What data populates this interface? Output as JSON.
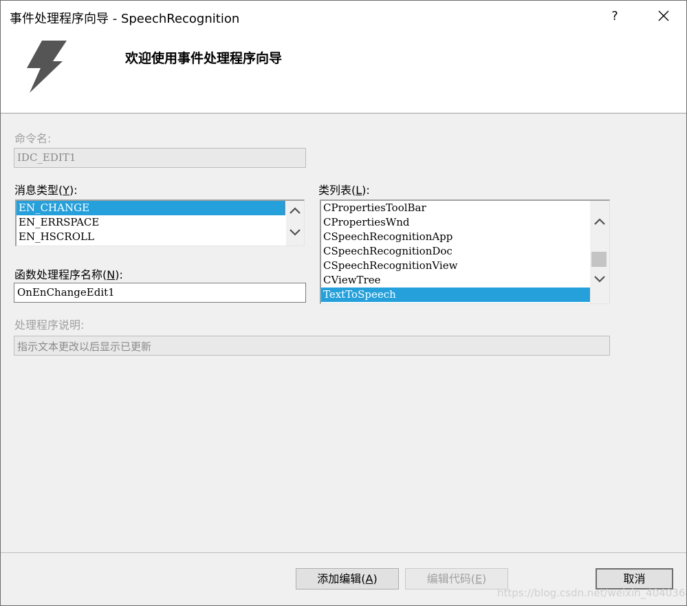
{
  "window": {
    "title": "事件处理程序向导 - SpeechRecognition",
    "help_label": "?",
    "close_icon": "close-icon"
  },
  "header": {
    "title": "欢迎使用事件处理程序向导",
    "icon": "lightning-bolt-icon"
  },
  "command_name": {
    "label": "命令名:",
    "value": "IDC_EDIT1"
  },
  "message_type": {
    "label_pre": "消息类型(",
    "label_key": "Y",
    "label_post": "):",
    "items": [
      "EN_CHANGE",
      "EN_ERRSPACE",
      "EN_HSCROLL"
    ],
    "selected": "EN_CHANGE"
  },
  "class_list": {
    "label_pre": "类列表(",
    "label_key": "L",
    "label_post": "):",
    "items": [
      "CPropertiesToolBar",
      "CPropertiesWnd",
      "CSpeechRecognitionApp",
      "CSpeechRecognitionDoc",
      "CSpeechRecognitionView",
      "CViewTree",
      "TextToSpeech"
    ],
    "selected": "TextToSpeech"
  },
  "handler_name": {
    "label_pre": "函数处理程序名称(",
    "label_key": "N",
    "label_post": "):",
    "value": "OnEnChangeEdit1"
  },
  "handler_desc": {
    "label": "处理程序说明:",
    "value": "指示文本更改以后显示已更新"
  },
  "buttons": {
    "add_edit_pre": "添加编辑(",
    "add_edit_key": "A",
    "add_edit_post": ")",
    "edit_code_pre": "编辑代码(",
    "edit_code_key": "E",
    "edit_code_post": ")",
    "cancel": "取消"
  },
  "watermark": "https://blog.csdn.net/weixin_40403689",
  "colors": {
    "selection": "#26a0da",
    "window_bg": "#f0f0f0",
    "disabled_text": "#a0a0a0"
  }
}
